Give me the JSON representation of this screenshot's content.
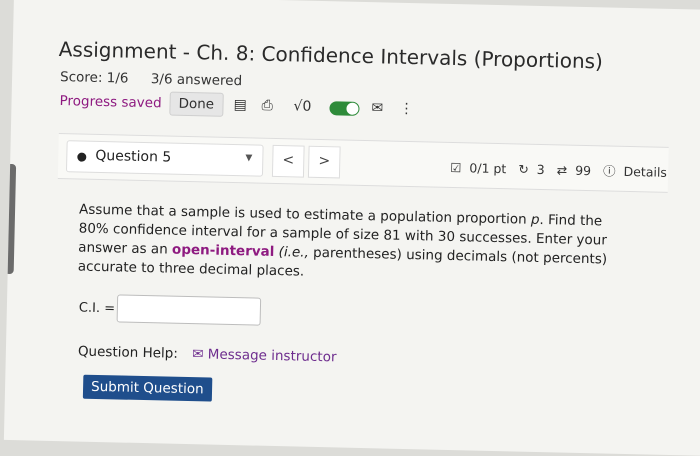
{
  "header": {
    "title": "Assignment - Ch. 8: Confidence Intervals (Proportions)",
    "score": "Score: 1/6",
    "answered": "3/6 answered",
    "progress_text": "Progress saved",
    "done_label": "Done",
    "tools": {
      "doc_icon": "▤",
      "print_icon": "⎙",
      "math_label": "√0",
      "mail_icon": "✉",
      "more_icon": "⋮"
    }
  },
  "question_bar": {
    "selected_question": "Question 5",
    "prev": "<",
    "next": ">",
    "score_text": "0/1 pt",
    "retries": "3",
    "attempts": "99",
    "details": "Details"
  },
  "question": {
    "text_before_p": "Assume that a sample is used to estimate a population proportion ",
    "p": "p",
    "text_after_p": ". Find the 80% confidence interval for a sample of size 81 with 30 successes. Enter your answer as an ",
    "bold": "open-interval",
    "text_ie": " (i.e.,",
    "text_end": " parentheses) using decimals (not percents) accurate to three decimal places."
  },
  "answer": {
    "label": "C.I. =",
    "value": ""
  },
  "help": {
    "label": "Question Help:",
    "message": "Message instructor"
  },
  "submit_label": "Submit Question",
  "colors": {
    "accent": "#8e1a80",
    "button": "#1f4e8c",
    "toggle": "#2e8b3a"
  }
}
